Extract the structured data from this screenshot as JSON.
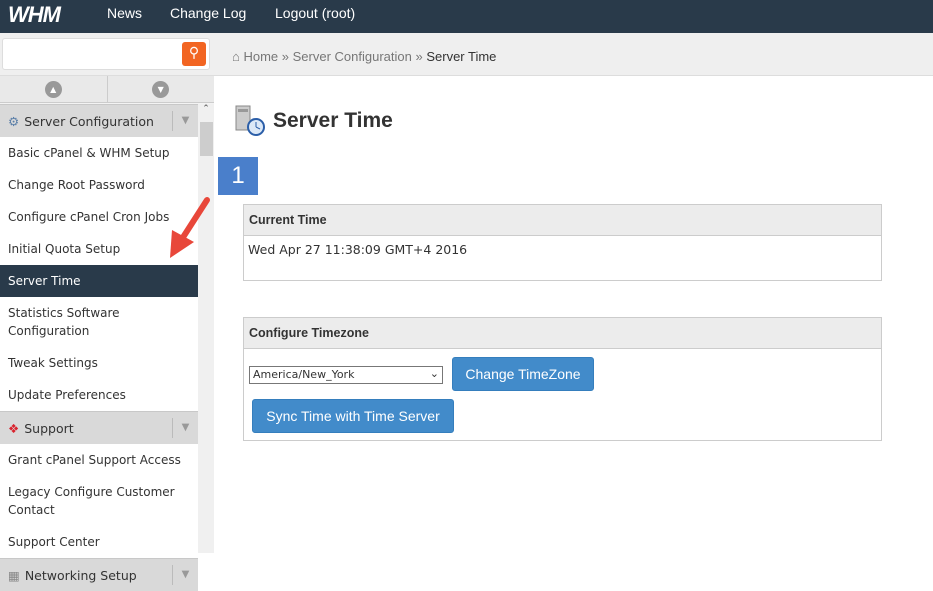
{
  "topbar": {
    "logo": "WHM",
    "nav": [
      "News",
      "Change Log",
      "Logout (root)"
    ]
  },
  "search": {
    "placeholder": ""
  },
  "breadcrumb": [
    "Home",
    "Server Configuration",
    "Server Time"
  ],
  "sidebar": {
    "sections": [
      {
        "title": "Server Configuration",
        "items": [
          "Basic cPanel & WHM Setup",
          "Change Root Password",
          "Configure cPanel Cron Jobs",
          "Initial Quota Setup",
          "Server Time",
          "Statistics Software Configuration",
          "Tweak Settings",
          "Update Preferences"
        ]
      },
      {
        "title": "Support",
        "items": [
          "Grant cPanel Support Access",
          "Legacy Configure Customer Contact",
          "Support Center"
        ]
      },
      {
        "title": "Networking Setup",
        "items": []
      }
    ],
    "active": "Server Time"
  },
  "page": {
    "title": "Server Time",
    "badge": "1",
    "current_time": {
      "header": "Current Time",
      "value": "Wed Apr 27 11:38:09 GMT+4 2016"
    },
    "timezone": {
      "header": "Configure Timezone",
      "selected": "America/New_York",
      "change_label": "Change TimeZone",
      "sync_label": "Sync Time with Time Server"
    }
  },
  "colors": {
    "topbar": "#293a4a",
    "accent": "#428bca",
    "search": "#f26522",
    "badge": "#4a7fcb",
    "arrow": "#e8473a"
  }
}
